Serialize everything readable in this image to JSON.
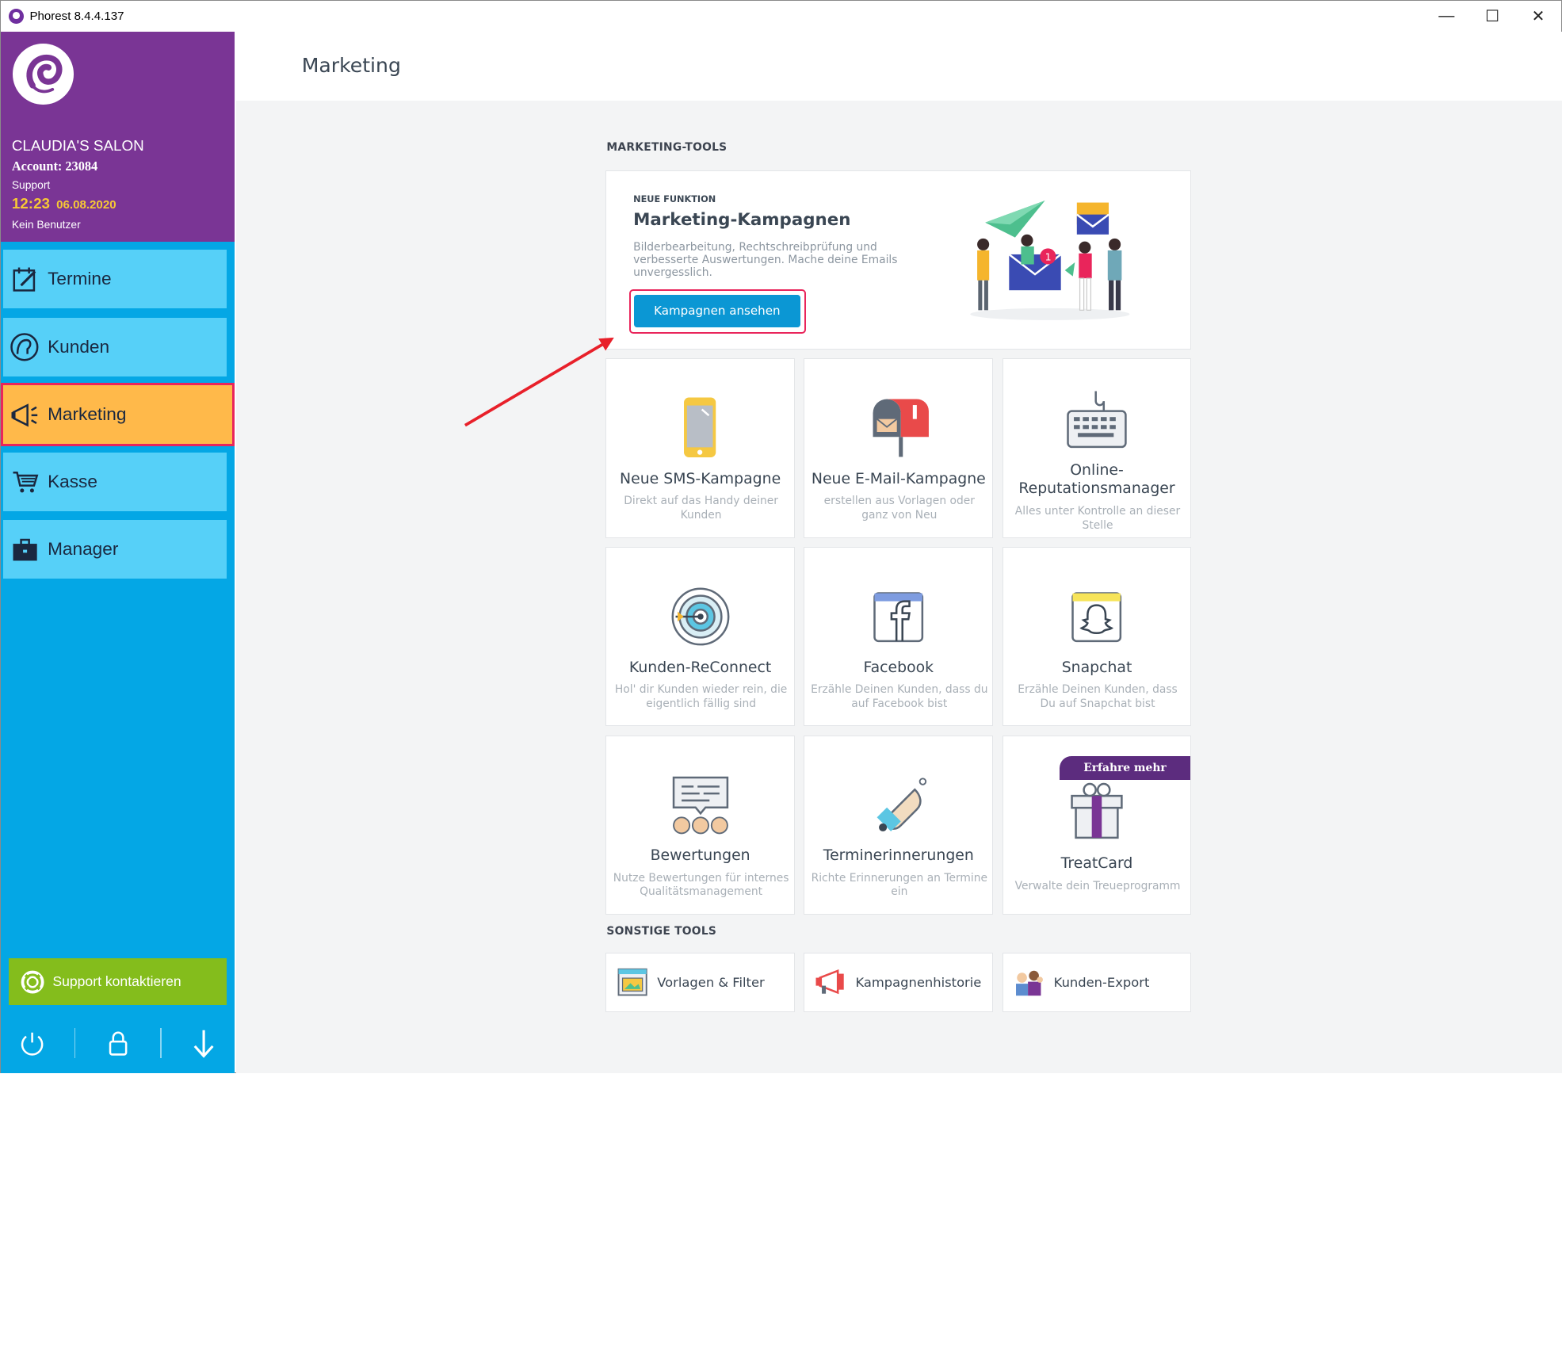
{
  "window": {
    "title": "Phorest 8.4.4.137"
  },
  "profile": {
    "salon_name": "CLAUDIA'S SALON",
    "account": "Account: 23084",
    "role": "Support",
    "time": "12:23",
    "date": "06.08.2020",
    "user": "Kein Benutzer"
  },
  "sidebar": {
    "items": [
      {
        "label": "Termine",
        "icon": "calendar-edit-icon"
      },
      {
        "label": "Kunden",
        "icon": "client-head-icon"
      },
      {
        "label": "Marketing",
        "icon": "megaphone-icon",
        "active": true
      },
      {
        "label": "Kasse",
        "icon": "shopping-cart-icon"
      },
      {
        "label": "Manager",
        "icon": "briefcase-icon"
      }
    ],
    "support_label": "Support kontaktieren"
  },
  "header": {
    "title": "Marketing"
  },
  "marketing_tools": {
    "section_label": "MARKETING-TOOLS",
    "feature": {
      "kicker": "NEUE FUNKTION",
      "title": "Marketing-Kampagnen",
      "description": "Bilderbearbeitung, Rechtschreibprüfung und verbesserte Auswertungen. Mache deine Emails unvergesslich.",
      "button_label": "Kampagnen ansehen"
    },
    "cards": [
      {
        "title": "Neue SMS-Kampagne",
        "description": "Direkt auf das Handy deiner Kunden",
        "icon": "phone-icon"
      },
      {
        "title": "Neue E-Mail-Kampagne",
        "description": "erstellen aus Vorlagen oder ganz von Neu",
        "icon": "mailbox-icon"
      },
      {
        "title": "Online-Reputationsmanager",
        "description": "Alles unter Kontrolle an dieser Stelle",
        "icon": "keyboard-icon"
      },
      {
        "title": "Kunden-ReConnect",
        "description": "Hol' dir Kunden wieder rein, die eigentlich fällig sind",
        "icon": "target-icon"
      },
      {
        "title": "Facebook",
        "description": "Erzähle Deinen Kunden, dass du auf Facebook bist",
        "icon": "facebook-icon"
      },
      {
        "title": "Snapchat",
        "description": "Erzähle Deinen Kunden, dass Du auf Snapchat bist",
        "icon": "snapchat-icon"
      },
      {
        "title": "Bewertungen",
        "description": "Nutze Bewertungen für internes Qualitätsmanagement",
        "icon": "reviews-icon"
      },
      {
        "title": "Terminerinnerungen",
        "description": "Richte Erinnerungen an Termine ein",
        "icon": "bell-icon"
      },
      {
        "title": "TreatCard",
        "description": "Verwalte dein Treueprogramm",
        "icon": "gift-icon",
        "ribbon": "Erfahre mehr"
      }
    ]
  },
  "other_tools": {
    "section_label": "SONSTIGE TOOLS",
    "items": [
      {
        "label": "Vorlagen & Filter",
        "icon": "template-icon"
      },
      {
        "label": "Kampagnenhistorie",
        "icon": "megaphone-history-icon"
      },
      {
        "label": "Kunden-Export",
        "icon": "users-export-icon"
      }
    ]
  },
  "colors": {
    "sidebar_bg": "#04a7e5",
    "profile_bg": "#7a3595",
    "nav_item": "#56d0f8",
    "nav_active": "#ffb94a",
    "highlight": "#e9255b",
    "support_button": "#84bd1c",
    "cta": "#0b97d4"
  }
}
